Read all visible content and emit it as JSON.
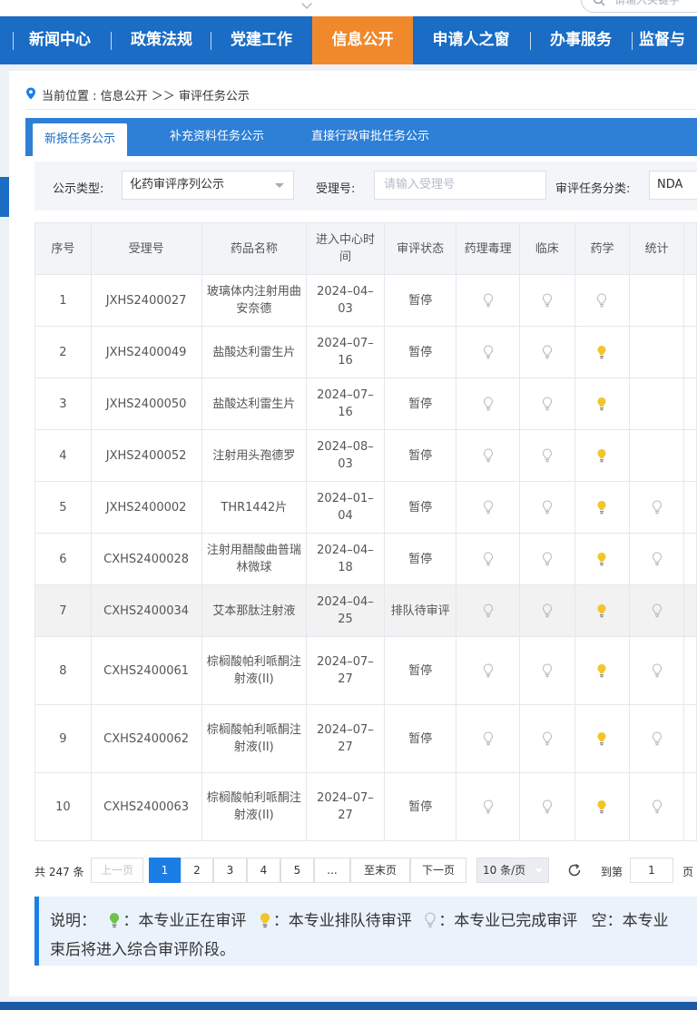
{
  "search": {
    "placeholder": "请输入关键字"
  },
  "nav": {
    "items": [
      {
        "label": "新闻中心"
      },
      {
        "label": "政策法规"
      },
      {
        "label": "党建工作"
      },
      {
        "label": "信息公开",
        "active": true
      },
      {
        "label": "申请人之窗"
      },
      {
        "label": "办事服务"
      },
      {
        "label": "监督与"
      }
    ]
  },
  "breadcrumb": {
    "text": "当前位置 : 信息公开 ＞＞ 审评任务公示"
  },
  "tabs": [
    {
      "label": "新报任务公示",
      "active": true
    },
    {
      "label": "补充资料任务公示"
    },
    {
      "label": "直接行政审批任务公示"
    }
  ],
  "filter": {
    "type_label": "公示类型:",
    "type_value": "化药审评序列公示",
    "accept_label": "受理号:",
    "accept_placeholder": "请输入受理号",
    "category_label": "审评任务分类:",
    "category_value": "NDA"
  },
  "table": {
    "headers": [
      "序号",
      "受理号",
      "药品名称",
      "进入中心时间",
      "审评状态",
      "药理毒理",
      "临床",
      "药学",
      "统计"
    ],
    "rows": [
      {
        "no": "1",
        "acc": "JXHS2400027",
        "name": "玻璃体内注射用曲安奈德",
        "date": "2024–04–03",
        "status": "暂停",
        "pharm": "done",
        "clin": "done",
        "chem": "done",
        "stat": ""
      },
      {
        "no": "2",
        "acc": "JXHS2400049",
        "name": "盐酸达利雷生片",
        "date": "2024–07–16",
        "status": "暂停",
        "pharm": "done",
        "clin": "done",
        "chem": "queued",
        "stat": ""
      },
      {
        "no": "3",
        "acc": "JXHS2400050",
        "name": "盐酸达利雷生片",
        "date": "2024–07–16",
        "status": "暂停",
        "pharm": "done",
        "clin": "done",
        "chem": "queued",
        "stat": ""
      },
      {
        "no": "4",
        "acc": "JXHS2400052",
        "name": "注射用头孢德罗",
        "date": "2024–08–03",
        "status": "暂停",
        "pharm": "done",
        "clin": "done",
        "chem": "queued",
        "stat": ""
      },
      {
        "no": "5",
        "acc": "JXHS2400002",
        "name": "THR1442片",
        "date": "2024–01–04",
        "status": "暂停",
        "pharm": "done",
        "clin": "done",
        "chem": "queued",
        "stat": "done"
      },
      {
        "no": "6",
        "acc": "CXHS2400028",
        "name": "注射用醋酸曲普瑞林微球",
        "date": "2024–04–18",
        "status": "暂停",
        "pharm": "done",
        "clin": "done",
        "chem": "queued",
        "stat": "done"
      },
      {
        "no": "7",
        "acc": "CXHS2400034",
        "name": "艾本那肽注射液",
        "date": "2024–04–25",
        "status": "排队待审评",
        "pharm": "done",
        "clin": "done",
        "chem": "queued",
        "stat": "done"
      },
      {
        "no": "8",
        "acc": "CXHS2400061",
        "name": "棕榈酸帕利哌酮注射液(II)",
        "date": "2024–07–27",
        "status": "暂停",
        "pharm": "done",
        "clin": "done",
        "chem": "queued",
        "stat": "done"
      },
      {
        "no": "9",
        "acc": "CXHS2400062",
        "name": "棕榈酸帕利哌酮注射液(II)",
        "date": "2024–07–27",
        "status": "暂停",
        "pharm": "done",
        "clin": "done",
        "chem": "queued",
        "stat": "done"
      },
      {
        "no": "10",
        "acc": "CXHS2400063",
        "name": "棕榈酸帕利哌酮注射液(II)",
        "date": "2024–07–27",
        "status": "暂停",
        "pharm": "done",
        "clin": "done",
        "chem": "queued",
        "stat": "done"
      }
    ]
  },
  "pager": {
    "total": "共 247 条",
    "prev": "上一页",
    "pages": [
      "1",
      "2",
      "3",
      "4",
      "5",
      "..."
    ],
    "active_page": "1",
    "last": "至末页",
    "next": "下一页",
    "size": "10 条/页",
    "jump_label": "到第",
    "jump_value": "1",
    "page_unit": "页"
  },
  "note": {
    "label": "说明：",
    "green_text": "：本专业正在审评",
    "yellow_text": "：本专业排队待审评",
    "gray_text": "：本专业已完成审评",
    "empty_text": "空：本专业",
    "line2": "束后将进入综合审评阶段。"
  },
  "colors": {
    "nav_bg": "#1a6cc4",
    "nav_active": "#f0892b",
    "tab_bar": "#2e7fd6",
    "bulb_done": "#b5b9bf",
    "bulb_queued": "#f2c52b",
    "bulb_active": "#6cc24a"
  }
}
